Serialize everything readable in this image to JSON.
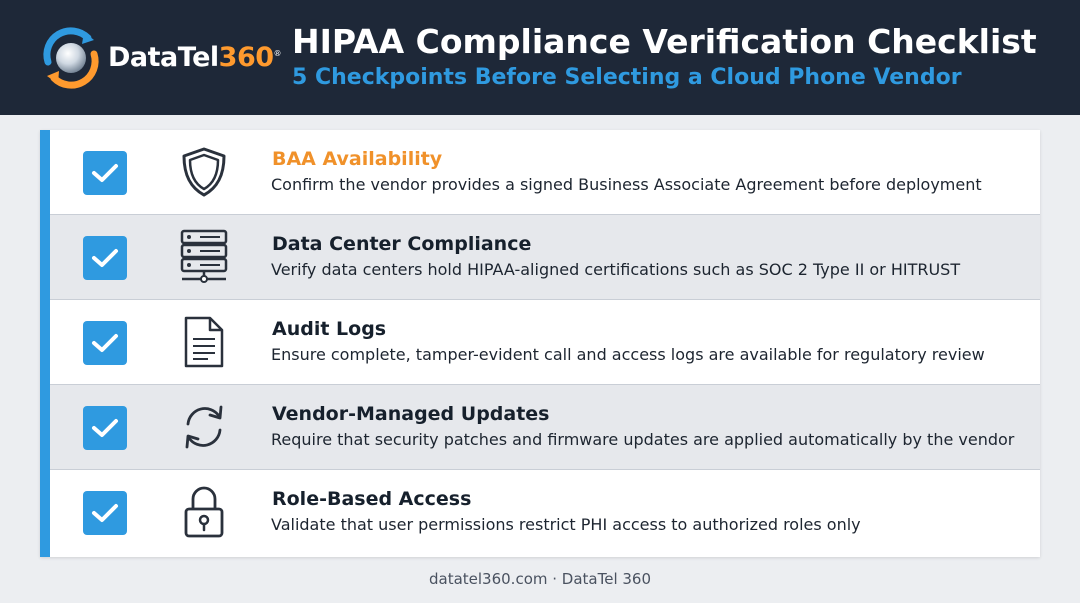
{
  "brand": {
    "name_prefix": "DataTel",
    "name_suffix": "360",
    "mark": "®",
    "accent_color": "#ff9a2e",
    "primary_color": "#2f9ae0",
    "header_bg": "#1e2838"
  },
  "header": {
    "title": "HIPAA Compliance Verification Checklist",
    "subtitle": "5 Checkpoints Before Selecting a Cloud Phone Vendor"
  },
  "checklist": [
    {
      "icon": "shield-icon",
      "checked": true,
      "title": "BAA Availability",
      "description": "Confirm the vendor provides a signed Business Associate Agreement before deployment"
    },
    {
      "icon": "server-icon",
      "checked": true,
      "title": "Data Center Compliance",
      "description": "Verify data centers hold HIPAA-aligned certifications such as SOC 2 Type II or HITRUST"
    },
    {
      "icon": "document-icon",
      "checked": true,
      "title": "Audit Logs",
      "description": "Ensure complete, tamper-evident call and access logs are available for regulatory review"
    },
    {
      "icon": "refresh-icon",
      "checked": true,
      "title": "Vendor-Managed Updates",
      "description": "Require that security patches and firmware updates are applied automatically by the vendor"
    },
    {
      "icon": "lock-icon",
      "checked": true,
      "title": "Role-Based Access",
      "description": "Validate that user permissions restrict PHI access to authorized roles only"
    }
  ],
  "footer": {
    "text": "datatel360.com · DataTel 360"
  }
}
